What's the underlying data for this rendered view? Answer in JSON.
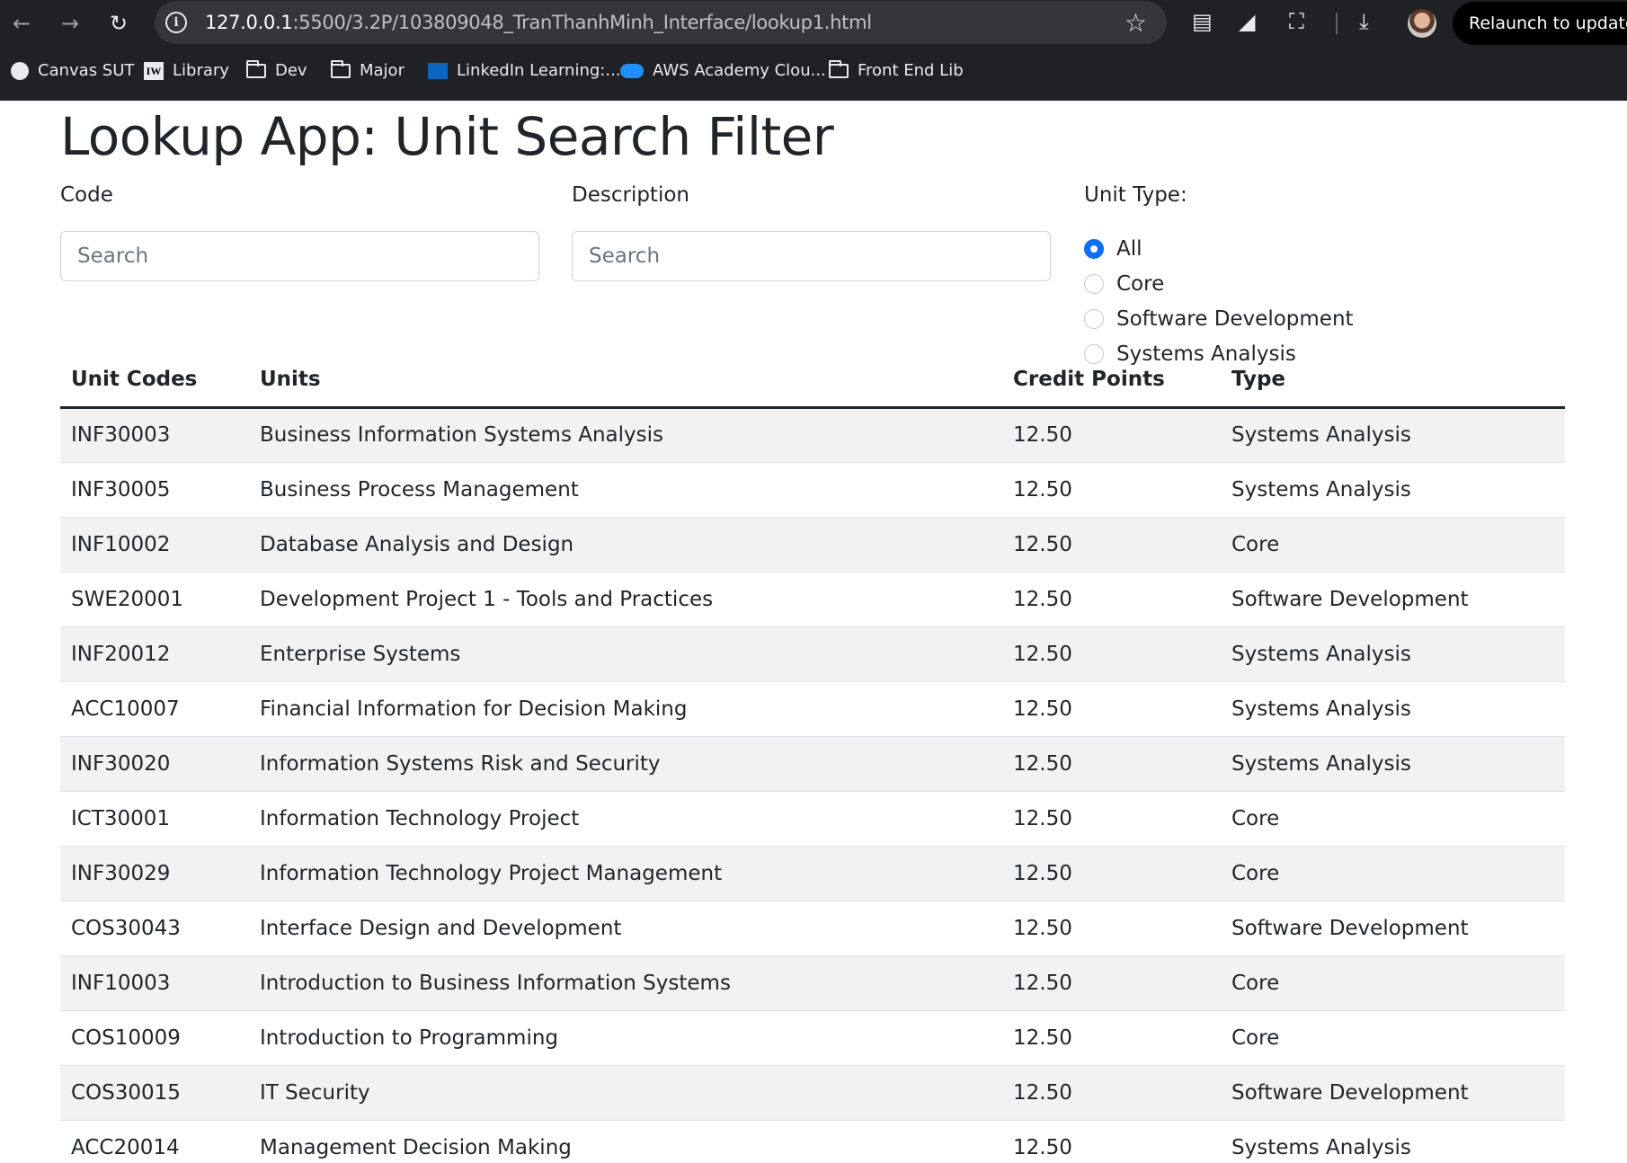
{
  "browser": {
    "url_host": "127.0.0.1",
    "url_rest": ":5500/3.2P/103809048_TranThanhMinh_Interface/lookup1.html",
    "relaunch_label": "Relaunch to update",
    "bookmarks": [
      {
        "label": "Canvas SUT",
        "icon": "globe-icon"
      },
      {
        "label": "Library",
        "icon": "iw-icon"
      },
      {
        "label": "Dev",
        "icon": "folder-icon"
      },
      {
        "label": "Major",
        "icon": "folder-icon"
      },
      {
        "label": "LinkedIn Learning:...",
        "icon": "linkedin-icon"
      },
      {
        "label": "AWS Academy Clou...",
        "icon": "cloud-icon"
      },
      {
        "label": "Front End Lib",
        "icon": "folder-icon"
      }
    ]
  },
  "page": {
    "title": "Lookup App: Unit Search Filter",
    "code_label": "Code",
    "description_label": "Description",
    "unit_type_label": "Unit Type:",
    "code_placeholder": "Search",
    "description_placeholder": "Search",
    "unit_types": [
      {
        "label": "All",
        "checked": true
      },
      {
        "label": "Core",
        "checked": false
      },
      {
        "label": "Software Development",
        "checked": false
      },
      {
        "label": "Systems Analysis",
        "checked": false
      }
    ]
  },
  "table": {
    "headers": [
      "Unit Codes",
      "Units",
      "Credit Points",
      "Type"
    ],
    "rows": [
      [
        "INF30003",
        "Business Information Systems Analysis",
        "12.50",
        "Systems Analysis"
      ],
      [
        "INF30005",
        "Business Process Management",
        "12.50",
        "Systems Analysis"
      ],
      [
        "INF10002",
        "Database Analysis and Design",
        "12.50",
        "Core"
      ],
      [
        "SWE20001",
        "Development Project 1 - Tools and Practices",
        "12.50",
        "Software Development"
      ],
      [
        "INF20012",
        "Enterprise Systems",
        "12.50",
        "Systems Analysis"
      ],
      [
        "ACC10007",
        "Financial Information for Decision Making",
        "12.50",
        "Systems Analysis"
      ],
      [
        "INF30020",
        "Information Systems Risk and Security",
        "12.50",
        "Systems Analysis"
      ],
      [
        "ICT30001",
        "Information Technology Project",
        "12.50",
        "Core"
      ],
      [
        "INF30029",
        "Information Technology Project Management",
        "12.50",
        "Core"
      ],
      [
        "COS30043",
        "Interface Design and Development",
        "12.50",
        "Software Development"
      ],
      [
        "INF10003",
        "Introduction to Business Information Systems",
        "12.50",
        "Core"
      ],
      [
        "COS10009",
        "Introduction to Programming",
        "12.50",
        "Core"
      ],
      [
        "COS30015",
        "IT Security",
        "12.50",
        "Software Development"
      ],
      [
        "ACC20014",
        "Management Decision Making",
        "12.50",
        "Systems Analysis"
      ]
    ]
  }
}
